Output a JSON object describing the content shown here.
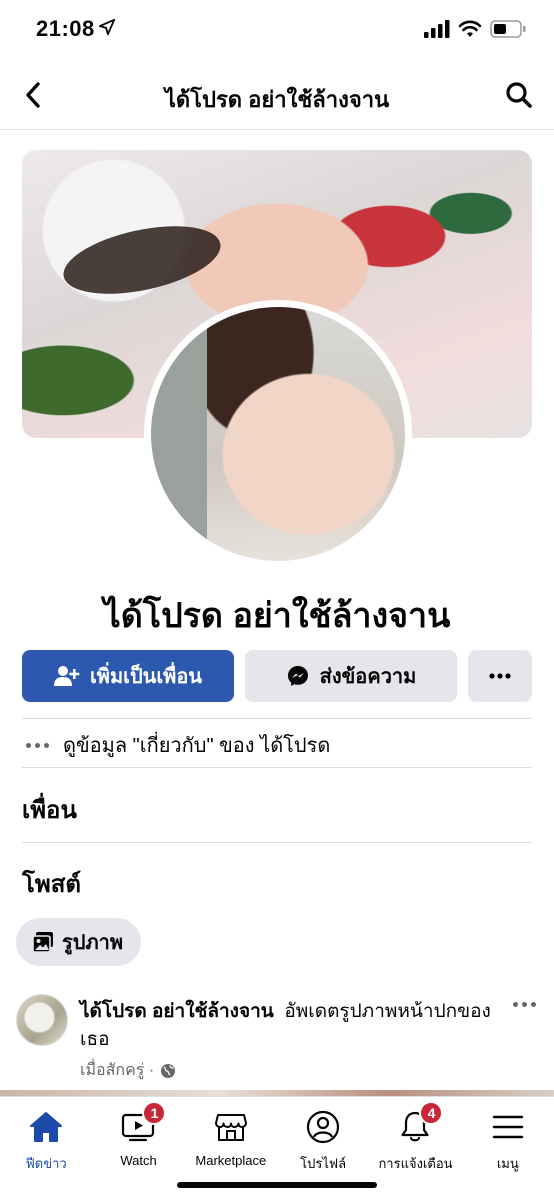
{
  "status_bar": {
    "time": "21:08"
  },
  "header": {
    "title": "ได้โปรด อย่าใช้ล้างจาน"
  },
  "profile": {
    "name": "ได้โปรด อย่าใช้ล้างจาน"
  },
  "actions": {
    "add_friend": "เพิ่มเป็นเพื่อน",
    "message": "ส่งข้อความ"
  },
  "about": {
    "text": "ดูข้อมูล \"เกี่ยวกับ\" ของ ได้โปรด"
  },
  "sections": {
    "friends": "เพื่อน",
    "posts": "โพสต์"
  },
  "photo_chip": {
    "label": "รูปภาพ"
  },
  "post": {
    "author": "ได้โปรด อย่าใช้ล้างจาน",
    "action": "อัพเดตรูปภาพหน้าปกของเธอ",
    "time": "เมื่อสักครู่ ·"
  },
  "tabbar": {
    "accent": "#1b4aa8",
    "badge_color": "#c8273a",
    "items": [
      {
        "label": "ฟีดข่าว",
        "icon": "home-icon",
        "active": true
      },
      {
        "label": "Watch",
        "icon": "watch-icon",
        "badge": "1"
      },
      {
        "label": "Marketplace",
        "icon": "marketplace-icon"
      },
      {
        "label": "โปรไฟล์",
        "icon": "profile-icon"
      },
      {
        "label": "การแจ้งเตือน",
        "icon": "bell-icon",
        "badge": "4"
      },
      {
        "label": "เมนู",
        "icon": "menu-icon"
      }
    ]
  }
}
